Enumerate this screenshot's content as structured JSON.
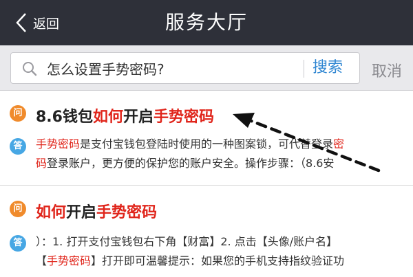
{
  "nav": {
    "back_label": "返回",
    "title": "服务大厅"
  },
  "search": {
    "value": "怎么设置手势密码?",
    "button_label": "搜索",
    "cancel_label": "取消"
  },
  "badges": {
    "question": "问",
    "answer": "答"
  },
  "results": [
    {
      "title_parts": [
        "8.6钱包",
        "如何",
        "开启",
        "手势密码"
      ],
      "answer_line1": [
        "手势密码",
        "是支付宝钱包登陆时使用的一种图案锁，可代替登录",
        "密"
      ],
      "answer_line2": [
        "码",
        "登录账户，更方便的保护您的账户安全。操作步骤：（8.6安"
      ]
    },
    {
      "title_parts": [
        "如何",
        "开启",
        "手势密码"
      ],
      "answer_line1": [
        "）：1. 打开支付宝钱包右下角【财富】2. 点击【头像/账户名】"
      ],
      "answer_line2": [
        "【",
        "手势密码",
        "】打开即可温馨提示：如果您的手机支持指纹验证功"
      ]
    }
  ],
  "colors": {
    "nav_bg": "#2e3039",
    "highlight": "#e0251b",
    "link_blue": "#2f86d2",
    "badge_q": "#f08b2c",
    "badge_a": "#47a7e4"
  }
}
